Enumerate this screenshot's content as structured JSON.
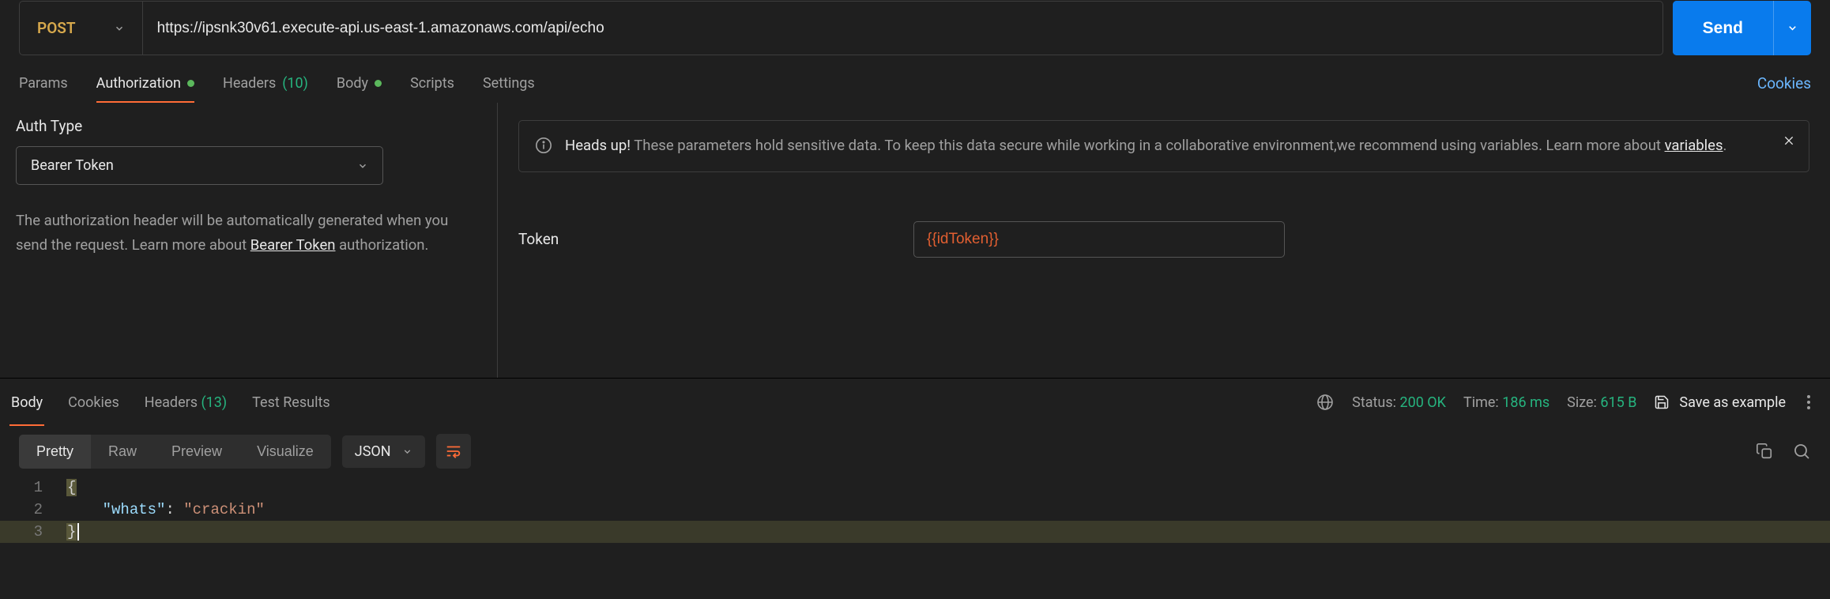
{
  "request": {
    "method": "POST",
    "url": "https://ipsnk30v61.execute-api.us-east-1.amazonaws.com/api/echo",
    "send_label": "Send"
  },
  "request_tabs": {
    "params": "Params",
    "authorization": "Authorization",
    "headers": "Headers",
    "headers_count": "(10)",
    "body": "Body",
    "scripts": "Scripts",
    "settings": "Settings",
    "cookies": "Cookies"
  },
  "auth": {
    "label": "Auth Type",
    "type_value": "Bearer Token",
    "help_prefix": "The authorization header will be automatically generated when you send the request. Learn more about ",
    "help_link": "Bearer Token",
    "help_suffix": " authorization.",
    "alert_heads": "Heads up!",
    "alert_text_1": " These parameters hold sensitive data. To keep this data secure while working in a collaborative environment,we recommend using variables. Learn more about ",
    "alert_link": "variables",
    "alert_text_2": ".",
    "token_label": "Token",
    "token_value": "{{idToken}}"
  },
  "response_tabs": {
    "body": "Body",
    "cookies": "Cookies",
    "headers": "Headers",
    "headers_count": "(13)",
    "test_results": "Test Results"
  },
  "response_meta": {
    "status_label": "Status:",
    "status_value": "200 OK",
    "time_label": "Time:",
    "time_value": "186 ms",
    "size_label": "Size:",
    "size_value": "615 B",
    "save_example": "Save as example"
  },
  "view": {
    "pretty": "Pretty",
    "raw": "Raw",
    "preview": "Preview",
    "visualize": "Visualize",
    "format": "JSON"
  },
  "code": {
    "l1_open": "{",
    "l2_indent": "    ",
    "l2_key": "\"whats\"",
    "l2_colon": ": ",
    "l2_val": "\"crackin\"",
    "l3_close": "}"
  }
}
